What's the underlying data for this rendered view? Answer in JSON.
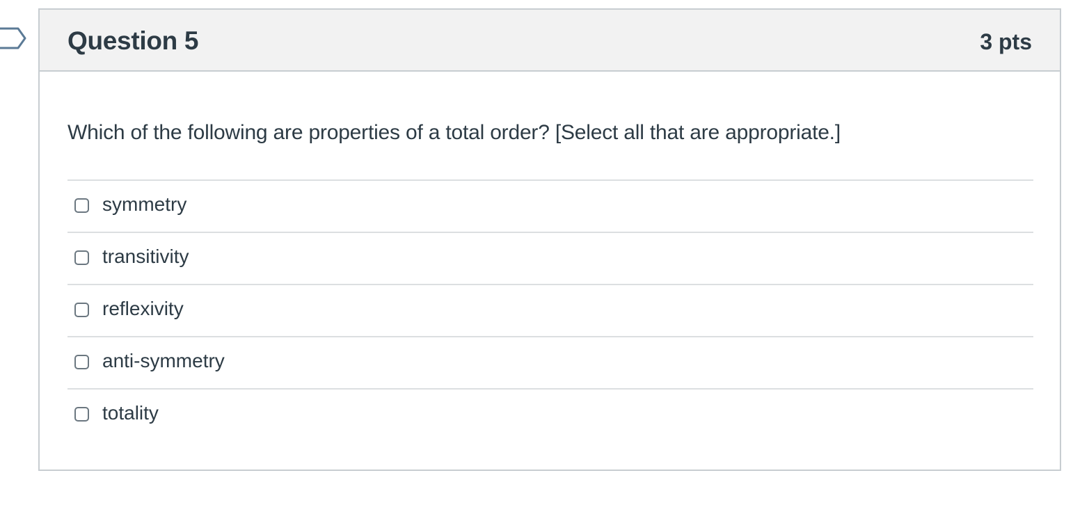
{
  "question": {
    "title": "Question 5",
    "points": "3 pts",
    "text": "Which of the following are properties of a total order?  [Select all that are appropriate.]",
    "answers": [
      {
        "label": "symmetry",
        "checked": false
      },
      {
        "label": "transitivity",
        "checked": false
      },
      {
        "label": "reflexivity",
        "checked": false
      },
      {
        "label": "anti-symmetry",
        "checked": false
      },
      {
        "label": "totality",
        "checked": false
      }
    ]
  },
  "colors": {
    "header_bg": "#f2f2f2",
    "border": "#c7cdd1",
    "text": "#2d3b45",
    "flag_stroke": "#5b7a96"
  },
  "icons": {
    "flag": "flag-question-icon"
  }
}
